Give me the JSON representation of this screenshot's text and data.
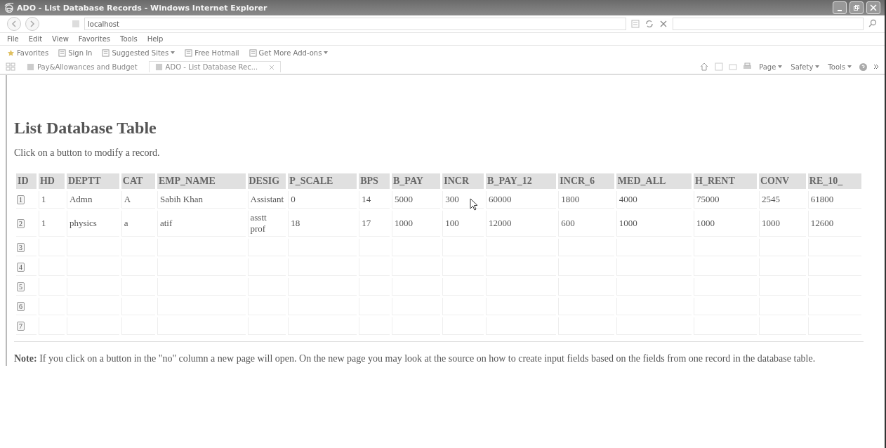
{
  "window": {
    "title": "ADO - List Database Records - Windows Internet Explorer"
  },
  "address_bar": {
    "value": "localhost"
  },
  "menu": [
    "File",
    "Edit",
    "View",
    "Favorites",
    "Tools",
    "Help"
  ],
  "favorites_bar": [
    {
      "label": "Favorites",
      "kind": "star",
      "dropdown": false
    },
    {
      "label": "Sign In",
      "kind": "page",
      "dropdown": false
    },
    {
      "label": "Suggested Sites",
      "kind": "page",
      "dropdown": true
    },
    {
      "label": "Free Hotmail",
      "kind": "page",
      "dropdown": false
    },
    {
      "label": "Get More Add-ons",
      "kind": "page",
      "dropdown": true
    }
  ],
  "tabs": [
    {
      "label": "Pay&Allowances and Budget",
      "selected": false,
      "closable": false
    },
    {
      "label": "ADO - List Database Rec...",
      "selected": true,
      "closable": true
    }
  ],
  "command_bar": [
    {
      "label": "Page"
    },
    {
      "label": "Safety"
    },
    {
      "label": "Tools"
    }
  ],
  "page": {
    "heading": "List Database Table",
    "intro": "Click on a button to modify a record.",
    "table": {
      "columns": [
        "ID",
        "HD",
        "DEPTT",
        "CAT",
        "EMP_NAME",
        "DESIG",
        "P_SCALE",
        "BPS",
        "B_PAY",
        "INCR",
        "B_PAY_12",
        "INCR_6",
        "MED_ALL",
        "H_RENT",
        "CONV",
        "RE_10_"
      ],
      "rows": [
        {
          "cells": [
            "1",
            "1",
            "Admn",
            "A",
            "Sabih Khan",
            "Assistant",
            "0",
            "14",
            "5000",
            "300",
            "60000",
            "1800",
            "4000",
            "75000",
            "2545",
            "61800"
          ]
        },
        {
          "cells": [
            "2",
            "1",
            "physics",
            "a",
            "atif",
            "asstt prof",
            "18",
            "17",
            "1000",
            "100",
            "12000",
            "600",
            "1000",
            "1000",
            "1000",
            "12600"
          ]
        },
        {
          "cells": [
            "3"
          ]
        },
        {
          "cells": [
            "4"
          ]
        },
        {
          "cells": [
            "5"
          ]
        },
        {
          "cells": [
            "6"
          ]
        },
        {
          "cells": [
            "7"
          ]
        }
      ]
    },
    "note": "**Note:** If you click on a button in the \"no\" column a new page will open. On the new page you may look at the source on how to create input fields based on the fields from one record in the database table."
  }
}
